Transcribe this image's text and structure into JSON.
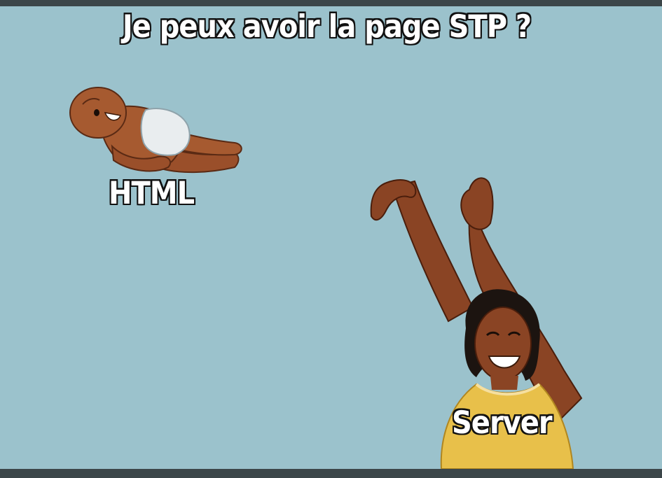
{
  "meme": {
    "top_text": "Je peux avoir la page STP ?",
    "baby_label": "HTML",
    "parent_label": "Server"
  },
  "colors": {
    "sky": "#9bc2cc",
    "frame": "#3c4649",
    "skin": "#a0522d",
    "diaper": "#e9edef",
    "shirt": "#e8c04a",
    "hair": "#1c1410",
    "text_fill": "#ffffff",
    "text_outline": "#111111"
  }
}
